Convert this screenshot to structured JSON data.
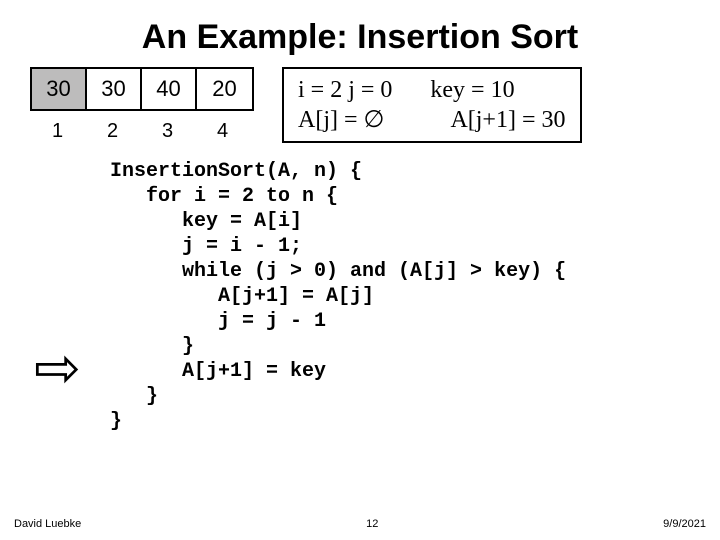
{
  "title": "An Example: Insertion Sort",
  "array": {
    "cells": [
      "30",
      "30",
      "40",
      "20"
    ],
    "indices": [
      "1",
      "2",
      "3",
      "4"
    ]
  },
  "state": {
    "line1_left": "i = 2    j = 0",
    "line1_right": "key = 10",
    "line2_left": "A[j] = ∅",
    "line2_right": "A[j+1] = 30"
  },
  "code": "InsertionSort(A, n) {\n   for i = 2 to n {\n      key = A[i]\n      j = i - 1;\n      while (j > 0) and (A[j] > key) {\n         A[j+1] = A[j]\n         j = j - 1\n      }\n      A[j+1] = key\n   }\n}",
  "arrow_glyph": "⇨",
  "footer": {
    "author": "David Luebke",
    "page": "12",
    "date": "9/9/2021"
  }
}
